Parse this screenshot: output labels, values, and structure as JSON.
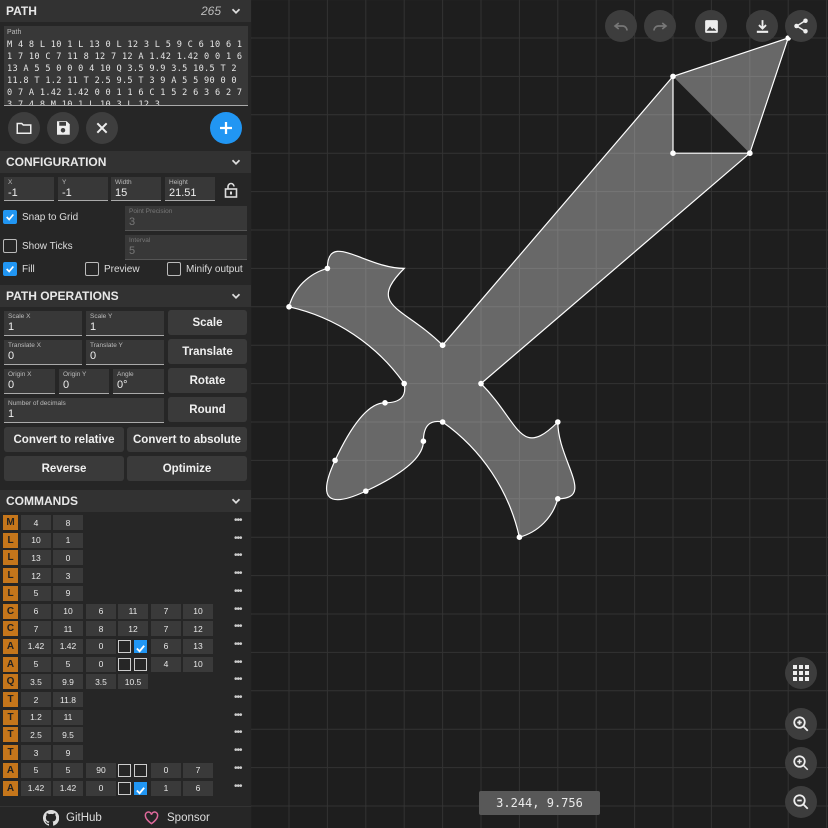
{
  "path_section": {
    "title": "PATH",
    "count": "265",
    "field_label": "Path",
    "value": "M 4 8 L 10 1 L 13 0 L 12 3 L 5 9 C 6 10 6 11 7 10 C 7 11 8 12 7 12 A 1.42 1.42 0 0 1 6 13 A 5 5 0 0 0 4 10 Q 3.5 9.9 3.5 10.5 T 2 11.8 T 1.2 11 T 2.5 9.5 T 3 9 A 5 5 90 0 0 0 7 A 1.42 1.42 0 0 1 1 6 C 1 5 2 6 3 6 2 7 3 7 4 8 M 10 1 L 10 3 L 12 3"
  },
  "config": {
    "title": "CONFIGURATION",
    "x": {
      "label": "X",
      "value": "-1"
    },
    "y": {
      "label": "Y",
      "value": "-1"
    },
    "width": {
      "label": "Width",
      "value": "15"
    },
    "height": {
      "label": "Height",
      "value": "21.51"
    },
    "snap": {
      "label": "Snap to Grid",
      "checked": true
    },
    "precision": {
      "label": "Point Precision",
      "value": "3"
    },
    "ticks": {
      "label": "Show Ticks",
      "checked": false
    },
    "interval": {
      "label": "Interval",
      "value": "5"
    },
    "fill": {
      "label": "Fill",
      "checked": true
    },
    "preview": {
      "label": "Preview",
      "checked": false
    },
    "minify": {
      "label": "Minify output",
      "checked": false
    }
  },
  "ops": {
    "title": "PATH OPERATIONS",
    "scale_x": {
      "label": "Scale X",
      "value": "1"
    },
    "scale_y": {
      "label": "Scale Y",
      "value": "1"
    },
    "scale_btn": "Scale",
    "translate_x": {
      "label": "Translate X",
      "value": "0"
    },
    "translate_y": {
      "label": "Translate Y",
      "value": "0"
    },
    "translate_btn": "Translate",
    "origin_x": {
      "label": "Origin X",
      "value": "0"
    },
    "origin_y": {
      "label": "Origin Y",
      "value": "0"
    },
    "angle": {
      "label": "Angle",
      "value": "0°"
    },
    "rotate_btn": "Rotate",
    "decimals": {
      "label": "Number of decimals",
      "value": "1"
    },
    "round_btn": "Round",
    "to_relative": "Convert to relative",
    "to_absolute": "Convert to absolute",
    "reverse": "Reverse",
    "optimize": "Optimize"
  },
  "commands": {
    "title": "COMMANDS",
    "more": "•••",
    "rows": [
      {
        "t": "M",
        "v": [
          "4",
          "8"
        ]
      },
      {
        "t": "L",
        "v": [
          "10",
          "1"
        ]
      },
      {
        "t": "L",
        "v": [
          "13",
          "0"
        ]
      },
      {
        "t": "L",
        "v": [
          "12",
          "3"
        ]
      },
      {
        "t": "L",
        "v": [
          "5",
          "9"
        ]
      },
      {
        "t": "C",
        "v": [
          "6",
          "10",
          "6",
          "11",
          "7",
          "10"
        ]
      },
      {
        "t": "C",
        "v": [
          "7",
          "11",
          "8",
          "12",
          "7",
          "12"
        ]
      },
      {
        "t": "A",
        "v": [
          "1.42",
          "1.42",
          "0"
        ],
        "flags": [
          false,
          true
        ],
        "end": [
          "6",
          "13"
        ]
      },
      {
        "t": "A",
        "v": [
          "5",
          "5",
          "0"
        ],
        "flags": [
          false,
          false
        ],
        "end": [
          "4",
          "10"
        ]
      },
      {
        "t": "Q",
        "v": [
          "3.5",
          "9.9",
          "3.5",
          "10.5"
        ]
      },
      {
        "t": "T",
        "v": [
          "2",
          "11.8"
        ]
      },
      {
        "t": "T",
        "v": [
          "1.2",
          "11"
        ]
      },
      {
        "t": "T",
        "v": [
          "2.5",
          "9.5"
        ]
      },
      {
        "t": "T",
        "v": [
          "3",
          "9"
        ]
      },
      {
        "t": "A",
        "v": [
          "5",
          "5",
          "90"
        ],
        "flags": [
          false,
          false
        ],
        "end": [
          "0",
          "7"
        ]
      },
      {
        "t": "A",
        "v": [
          "1.42",
          "1.42",
          "0"
        ],
        "flags": [
          false,
          true
        ],
        "end": [
          "1",
          "6"
        ]
      }
    ]
  },
  "footer": {
    "github": "GitHub",
    "sponsor": "Sponsor"
  },
  "canvas": {
    "coords": "3.244, 9.756"
  },
  "colors": {
    "accent": "#2196f3",
    "command_badge": "#c5761b",
    "panel": "#262626",
    "canvas": "#1e1e1e"
  }
}
